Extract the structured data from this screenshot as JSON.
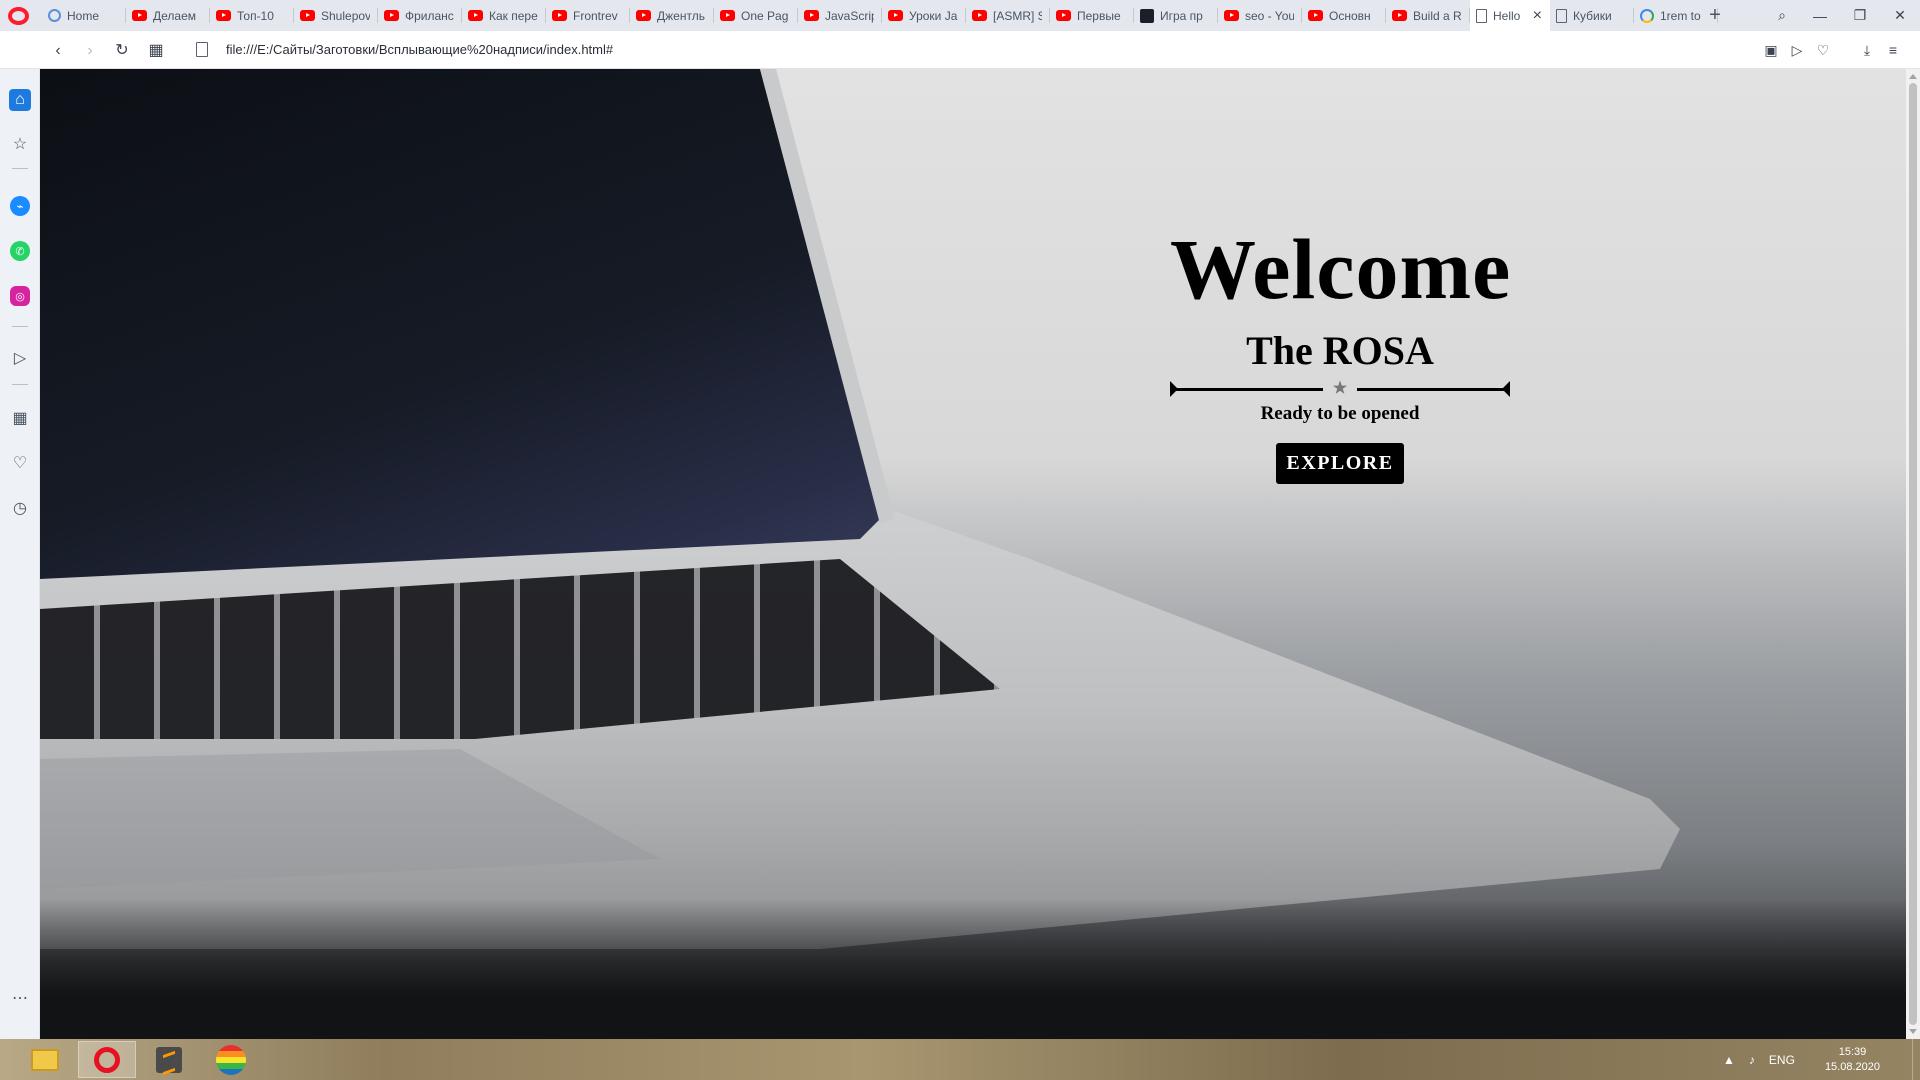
{
  "browser": {
    "tabs": [
      {
        "label": "Home",
        "icon": "home-icon"
      },
      {
        "label": "Делаем",
        "icon": "youtube-icon"
      },
      {
        "label": "Топ-10",
        "icon": "youtube-icon"
      },
      {
        "label": "Shulepov",
        "icon": "youtube-icon"
      },
      {
        "label": "Фриланс",
        "icon": "youtube-icon"
      },
      {
        "label": "Как пере",
        "icon": "youtube-icon"
      },
      {
        "label": "Frontrev",
        "icon": "youtube-icon"
      },
      {
        "label": "Джентль",
        "icon": "youtube-icon"
      },
      {
        "label": "One Pag",
        "icon": "youtube-icon"
      },
      {
        "label": "JavaScrip",
        "icon": "youtube-icon"
      },
      {
        "label": "Уроки Ja",
        "icon": "youtube-icon"
      },
      {
        "label": "[ASMR] S",
        "icon": "youtube-icon"
      },
      {
        "label": "Первые",
        "icon": "youtube-icon"
      },
      {
        "label": "Игра пр",
        "icon": "game-icon"
      },
      {
        "label": "seo - You",
        "icon": "youtube-icon"
      },
      {
        "label": "Основн",
        "icon": "youtube-icon"
      },
      {
        "label": "Build a R",
        "icon": "youtube-icon"
      },
      {
        "label": "Hello",
        "icon": "document-icon",
        "active": true
      },
      {
        "label": "Кубики",
        "icon": "document-icon"
      },
      {
        "label": "1rem to",
        "icon": "google-icon"
      }
    ],
    "new_tab_label": "+",
    "url": "file:///E:/Сайты/Заготовки/Всплывающие%20надписи/index.html#"
  },
  "page": {
    "title": "Welcome",
    "subtitle": "The ROSA",
    "divider_ornament": "★",
    "tagline": "Ready to be opened",
    "button_label": "EXPLORE"
  },
  "taskbar": {
    "language": "ENG",
    "time": "15:39",
    "date": "15.08.2020"
  }
}
